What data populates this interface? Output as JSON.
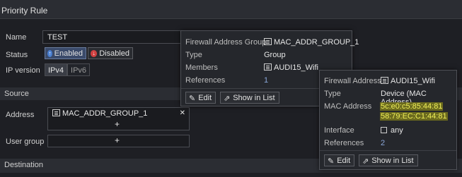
{
  "header": {
    "title": "Priority Rule"
  },
  "form": {
    "name_label": "Name",
    "name_value": "TEST",
    "status_label": "Status",
    "enabled_label": "Enabled",
    "disabled_label": "Disabled",
    "ipversion_label": "IP version",
    "ipv4_label": "IPv4",
    "ipv6_label": "IPv6"
  },
  "source": {
    "section_title": "Source",
    "address_label": "Address",
    "address_value": "MAC_ADDR_GROUP_1",
    "add_symbol": "+",
    "remove_symbol": "✕",
    "usergroup_label": "User group"
  },
  "destination": {
    "section_title": "Destination"
  },
  "group_popup": {
    "type_caption": "Firewall Address Group",
    "name": "MAC_ADDR_GROUP_1",
    "type_label": "Type",
    "type_value": "Group",
    "members_label": "Members",
    "member_value": "AUDI15_Wifi",
    "references_label": "References",
    "references_value": "1",
    "edit_label": "Edit",
    "show_label": "Show in List"
  },
  "address_popup": {
    "type_caption": "Firewall Address",
    "name": "AUDI15_Wifi",
    "type_label": "Type",
    "type_value": "Device (MAC Address)",
    "mac_label": "MAC Address",
    "mac_values": [
      "5c:e0:c5:85:44:81",
      "58:79:EC:C1:44:81"
    ],
    "interface_label": "Interface",
    "interface_value": "any",
    "references_label": "References",
    "references_value": "2",
    "edit_label": "Edit",
    "show_label": "Show in List"
  },
  "colors": {
    "background": "#1e1f24",
    "highlight": "#f0f05a",
    "link": "#8aa6d8",
    "enabled_icon": "#4a7fd0",
    "disabled_icon": "#d04040"
  }
}
